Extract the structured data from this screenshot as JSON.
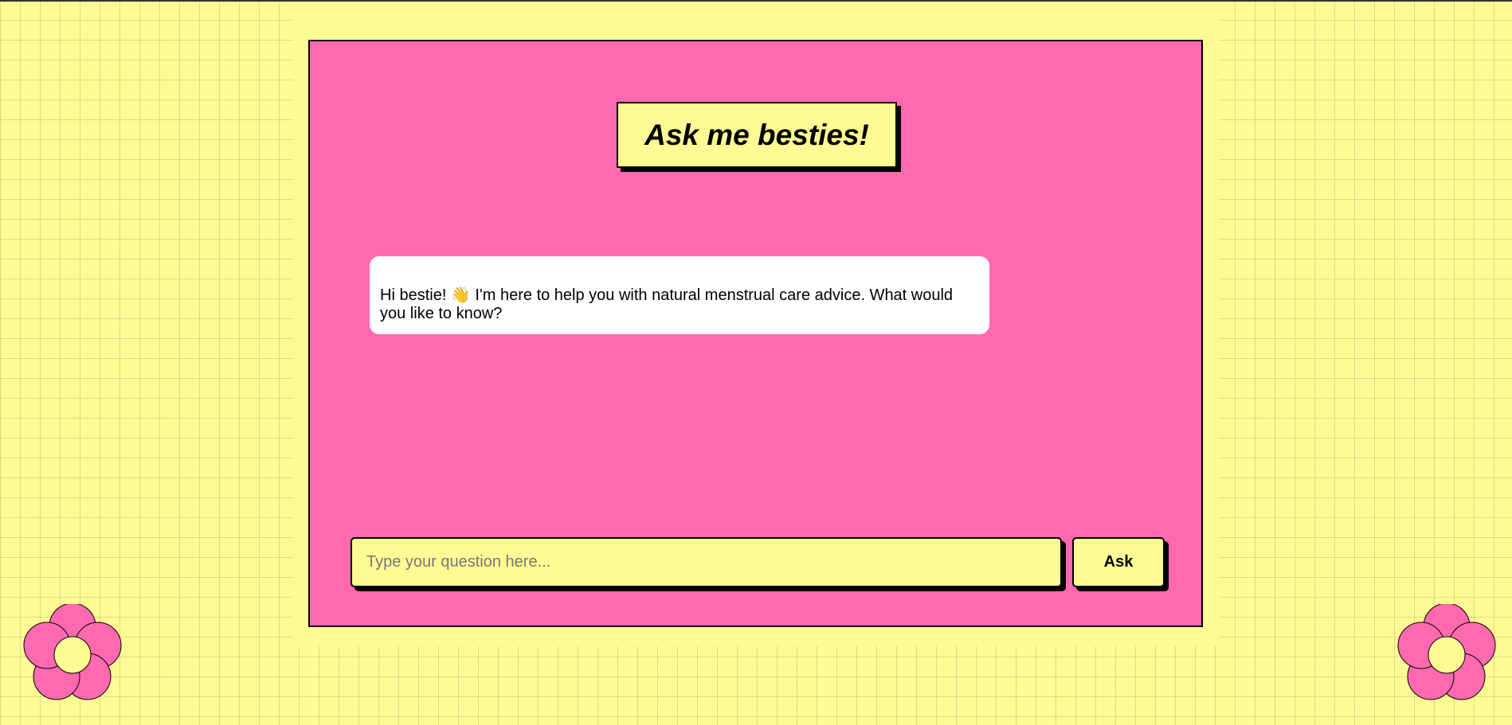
{
  "chat": {
    "title": "Ask me besties!",
    "messages": [
      {
        "sender": "bot",
        "text": "Hi bestie! 👋 I'm here to help you with natural menstrual care advice. What would you like to know?"
      }
    ],
    "input": {
      "placeholder": "Type your question here...",
      "value": ""
    },
    "ask_label": "Ask"
  },
  "decorations": {
    "flower_icon": "flower-icon",
    "petal_color": "#ff69b0",
    "center_color": "#fffb94"
  },
  "colors": {
    "background": "#fffb94",
    "card": "#ff69b0",
    "bubble": "#ffffff",
    "border": "#000000"
  }
}
